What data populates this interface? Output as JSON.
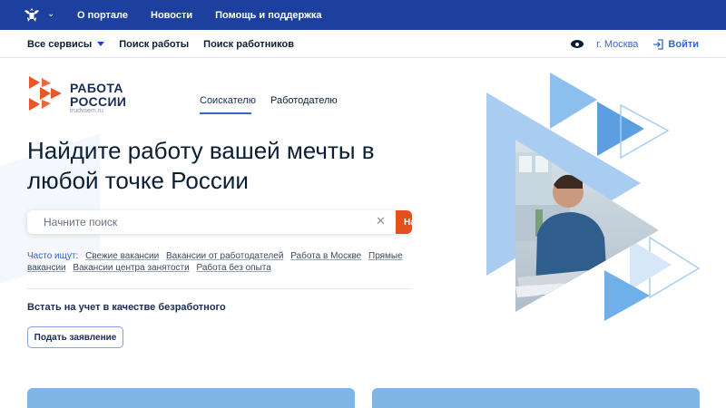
{
  "topbar": {
    "emblem_icon": "coat-of-arms-icon",
    "links": [
      "О портале",
      "Новости",
      "Помощь и поддержка"
    ]
  },
  "subbar": {
    "all_services": "Все сервисы",
    "find_job": "Поиск работы",
    "find_workers": "Поиск работников",
    "city": "г. Москва",
    "login": "Войти"
  },
  "logo": {
    "line1": "РАБОТА",
    "line2": "РОССИИ",
    "url": "trudvsem.ru"
  },
  "tabs": {
    "seeker": "Соискателю",
    "employer": "Работодателю"
  },
  "headline": "Найдите работу вашей мечты в любой точке России",
  "search": {
    "value": "",
    "placeholder": "Начните поиск",
    "button": "Найти"
  },
  "popular": {
    "label": "Часто ищут:",
    "links": [
      "Свежие вакансии",
      "Вакансии от работодателей",
      "Работа в Москве",
      "Прямые вакансии",
      "Вакансии центра занятости",
      "Работа без опыта"
    ]
  },
  "unemployed": {
    "title": "Встать на учет в качестве безработного",
    "button": "Подать заявление"
  },
  "colors": {
    "topbar": "#1d3f9e",
    "accent": "#3567c9",
    "search_button": "#e3501c",
    "logo_orange": "#e8562a",
    "hero_blue": "#7fb6e8"
  }
}
